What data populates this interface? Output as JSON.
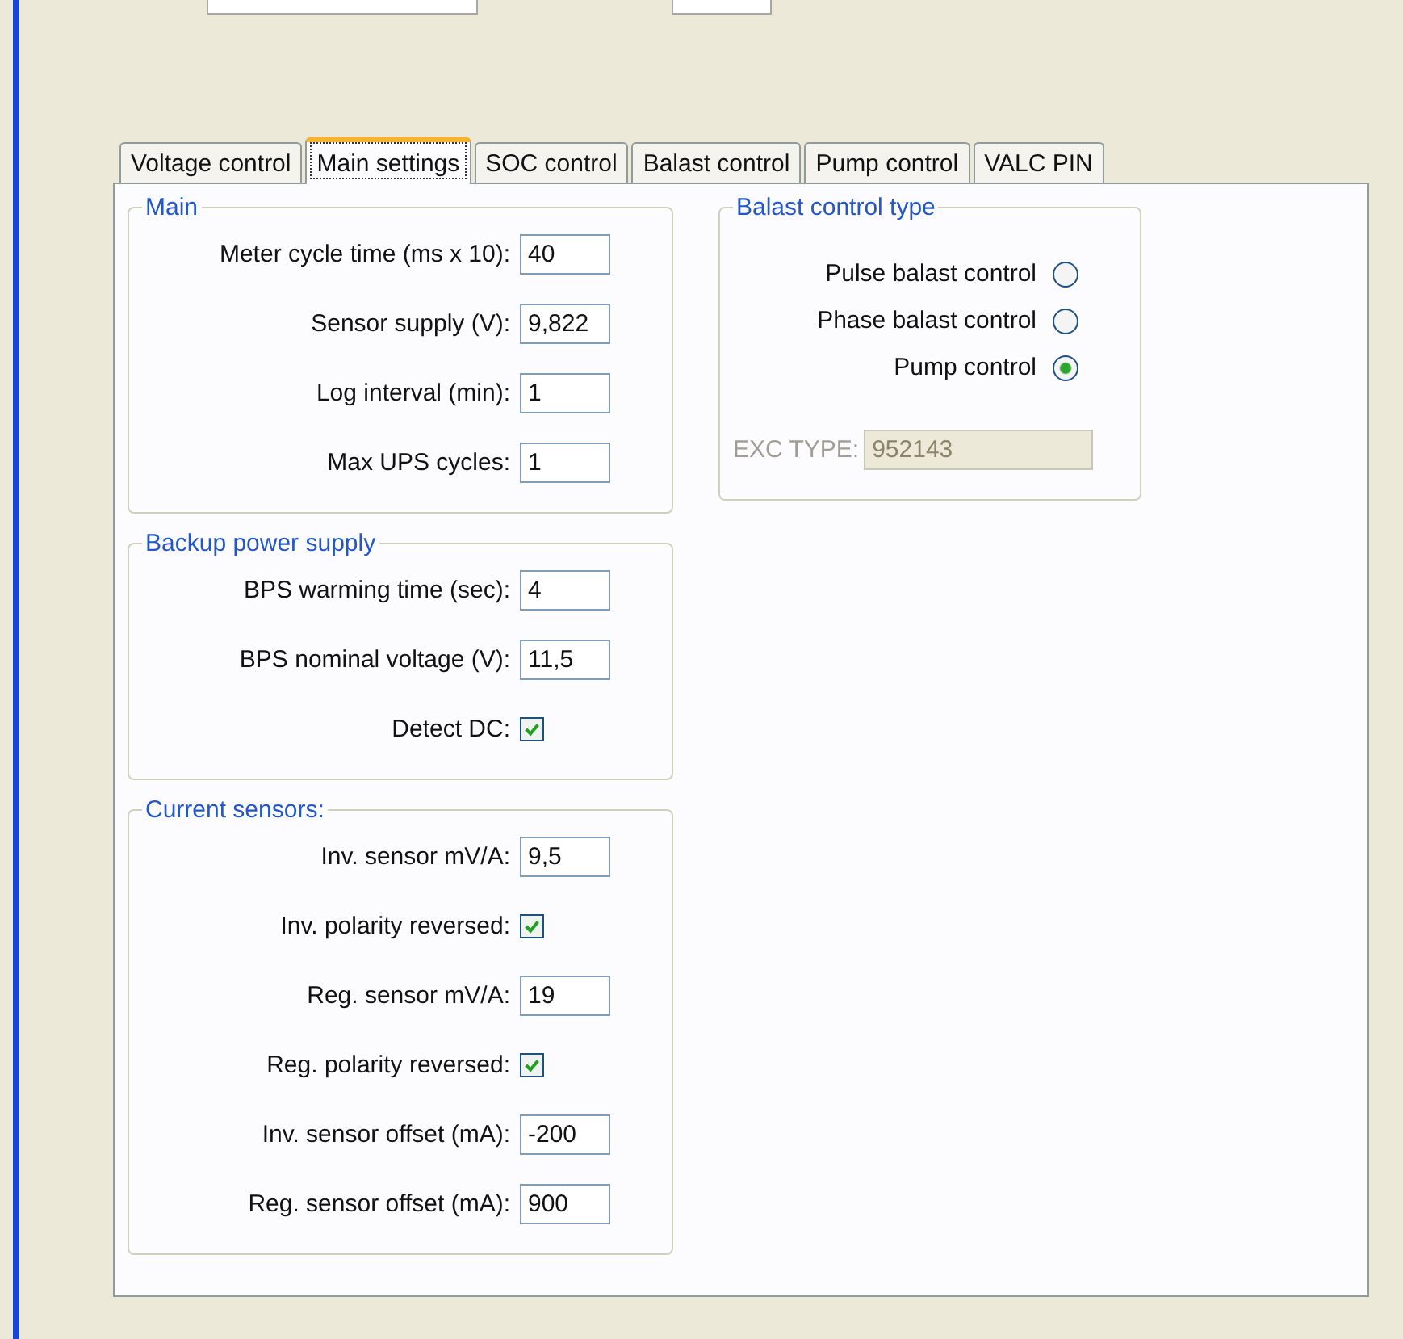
{
  "tabs": [
    {
      "label": "Voltage control",
      "selected": false
    },
    {
      "label": "Main settings",
      "selected": true
    },
    {
      "label": "SOC control",
      "selected": false
    },
    {
      "label": "Balast control",
      "selected": false
    },
    {
      "label": "Pump control",
      "selected": false
    },
    {
      "label": "VALC PIN",
      "selected": false
    }
  ],
  "left_groups": [
    {
      "title": "Main",
      "rows": [
        {
          "kind": "field",
          "label": "Meter cycle time (ms x 10):",
          "value": "40"
        },
        {
          "kind": "field",
          "label": "Sensor supply (V):",
          "value": "9,822"
        },
        {
          "kind": "field",
          "label": "Log interval (min):",
          "value": "1"
        },
        {
          "kind": "field",
          "label": "Max UPS cycles:",
          "value": "1"
        }
      ]
    },
    {
      "title": "Backup power supply",
      "rows": [
        {
          "kind": "field",
          "label": "BPS warming time (sec):",
          "value": "4"
        },
        {
          "kind": "field",
          "label": "BPS nominal voltage (V):",
          "value": "11,5"
        },
        {
          "kind": "checkbox",
          "label": "Detect DC:",
          "checked": true
        }
      ]
    },
    {
      "title": "Current sensors:",
      "rows": [
        {
          "kind": "field",
          "label": "Inv. sensor mV/A:",
          "value": "9,5"
        },
        {
          "kind": "checkbox",
          "label": "Inv. polarity reversed:",
          "checked": true
        },
        {
          "kind": "field",
          "label": "Reg. sensor mV/A:",
          "value": "19"
        },
        {
          "kind": "checkbox",
          "label": "Reg. polarity reversed:",
          "checked": true
        },
        {
          "kind": "field",
          "label": "Inv. sensor offset (mA):",
          "value": "-200"
        },
        {
          "kind": "field",
          "label": "Reg. sensor offset (mA):",
          "value": "900"
        }
      ]
    }
  ],
  "balast_group": {
    "title": "Balast control type",
    "options": [
      {
        "label": "Pulse balast control",
        "selected": false
      },
      {
        "label": "Phase balast control",
        "selected": false
      },
      {
        "label": "Pump control",
        "selected": true
      }
    ],
    "exc_type": {
      "label": "EXC TYPE:",
      "value": "952143",
      "disabled": true
    }
  }
}
